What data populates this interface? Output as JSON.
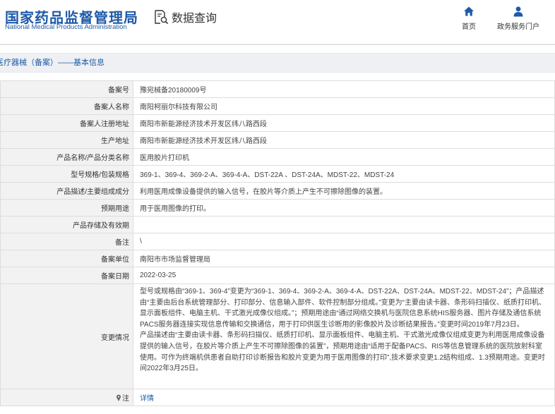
{
  "header": {
    "logo_cn": "国家药品监督管理局",
    "logo_en": "National Medical Products Administration",
    "query_label": "数据查询",
    "query_icon": "search-document-icon",
    "nav": [
      {
        "label": "首页",
        "icon": "home-icon"
      },
      {
        "label": "政务服务门户",
        "icon": "user-icon"
      }
    ]
  },
  "breadcrumb": {
    "category": "医疗器械（备案）",
    "separator": "——",
    "page": "基本信息"
  },
  "record": {
    "rows": [
      {
        "key": "备案号",
        "value": "豫宛械备20180009号"
      },
      {
        "key": "备案人名称",
        "value": "南阳柯丽尔科技有限公司"
      },
      {
        "key": "备案人注册地址",
        "value": "南阳市新能源经济技术开发区纬八路西段"
      },
      {
        "key": "生产地址",
        "value": "南阳市新能源经济技术开发区纬八路西段"
      },
      {
        "key": "产品名称/产品分类名称",
        "value": "医用胶片打印机"
      },
      {
        "key": "型号规格/包装规格",
        "value": "369-1、369-4、369-2-A、369-4-A、DST-22A 、DST-24A、MDST-22、MDST-24"
      },
      {
        "key": "产品描述/主要组成成分",
        "value": "利用医用成像设备提供的输入信号，在胶片等介质上产生不可擦除图像的装置。"
      },
      {
        "key": "预期用途",
        "value": "用于医用图像的打印。"
      },
      {
        "key": "产品存储及有效期",
        "value": ""
      },
      {
        "key": "备注",
        "value": "\\"
      },
      {
        "key": "备案单位",
        "value": "南阳市市场监督管理局"
      },
      {
        "key": "备案日期",
        "value": "2022-03-25"
      }
    ],
    "change": {
      "key": "变更情况",
      "paragraphs": [
        "型号或规格由“369-1、369-4”变更为“369-1、369-4、369-2-A、369-4-A、DST-22A、DST-24A、MDST-22、MDST-24”；产品描述由“主要由后台系统管理部分、打印部分、信息输入部件、软件控制部分组成。”变更为“主要由读卡器、条形码扫描仪、纸质打印机、显示面板组件、电脑主机、干式激光成像仪组成。”；预期用途由“通过网络交换机与医院信息系统HIS服务器、图片存储及通信系统PACS服务器连接实现信息传输和交换通信，用于打印供医生诊断用的影像胶片及诊断结果报告。”变更时间2019年7月23日。",
        "产品描述由“主要由读卡器、条形码扫描仪、纸质打印机、显示面板组件、电脑主机、干式激光成像仪组成变更为利用医用成像设备提供的输入信号，在胶片等介质上产生不可擦除图像的装置”，预期用途由“适用于配备PACS、RIS等信息管理系统的医院放射科室使用。可作为终端机供患者自助打印诊断报告和胶片变更为用于医用图像的打印”,技术要求变更1.2结构组成、1.3预期用途。变更时间2022年3月25日。"
      ]
    },
    "note": {
      "key": "注",
      "key_icon": "pin-icon",
      "link": "详情"
    }
  }
}
